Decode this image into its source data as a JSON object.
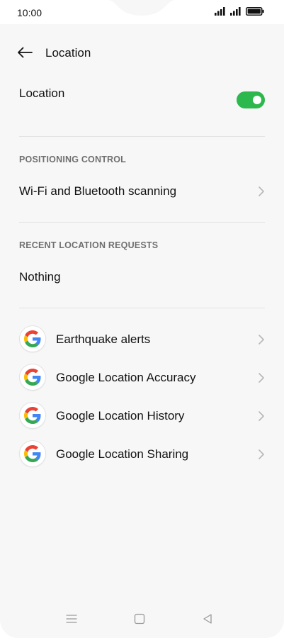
{
  "status_bar": {
    "time": "10:00",
    "icons": [
      "signal-icon",
      "signal-icon",
      "battery-icon"
    ]
  },
  "header": {
    "title": "Location",
    "back_icon": "back-arrow-icon"
  },
  "location_toggle": {
    "label": "Location",
    "state": "on",
    "accent_color": "#2db84d"
  },
  "positioning_control": {
    "section_title": "POSITIONING CONTROL",
    "items": [
      {
        "label": "Wi-Fi and Bluetooth scanning",
        "icon": "chevron-right-icon"
      }
    ]
  },
  "recent_requests": {
    "section_title": "RECENT LOCATION REQUESTS",
    "empty_text": "Nothing"
  },
  "services": {
    "items": [
      {
        "label": "Earthquake alerts",
        "icon": "google-icon"
      },
      {
        "label": "Google Location Accuracy",
        "icon": "google-icon"
      },
      {
        "label": "Google Location History",
        "icon": "google-icon"
      },
      {
        "label": "Google Location Sharing",
        "icon": "google-icon"
      }
    ]
  },
  "nav_bar": {
    "buttons": [
      "menu-icon",
      "home-square-icon",
      "back-triangle-icon"
    ]
  }
}
